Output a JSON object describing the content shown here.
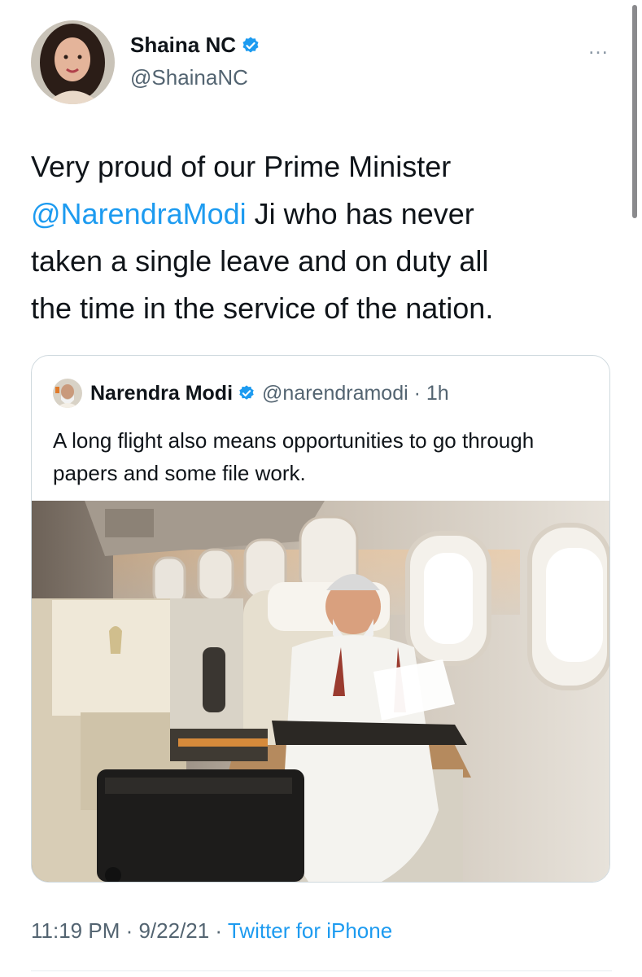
{
  "author": {
    "display_name": "Shaina NC",
    "handle": "@ShainaNC",
    "avatar_icon": "profile-avatar"
  },
  "more_icon": "…",
  "tweet": {
    "text_before": "Very proud of our Prime Minister\n",
    "mention": "@NarendraModi",
    "text_after": " Ji who has never\ntaken a single leave and on duty all\nthe time in the service of the nation."
  },
  "quoted_tweet": {
    "display_name": "Narendra Modi",
    "handle_time": "@narendramodi · 1h",
    "text": "A long flight also means opportunities to go through papers and some file work."
  },
  "footer": {
    "time": "11:19 PM · 9/22/21 · ",
    "source": "Twitter for iPhone"
  },
  "colors": {
    "link": "#1d9bf0",
    "secondary_text": "#536471",
    "border": "#cfd9de"
  }
}
